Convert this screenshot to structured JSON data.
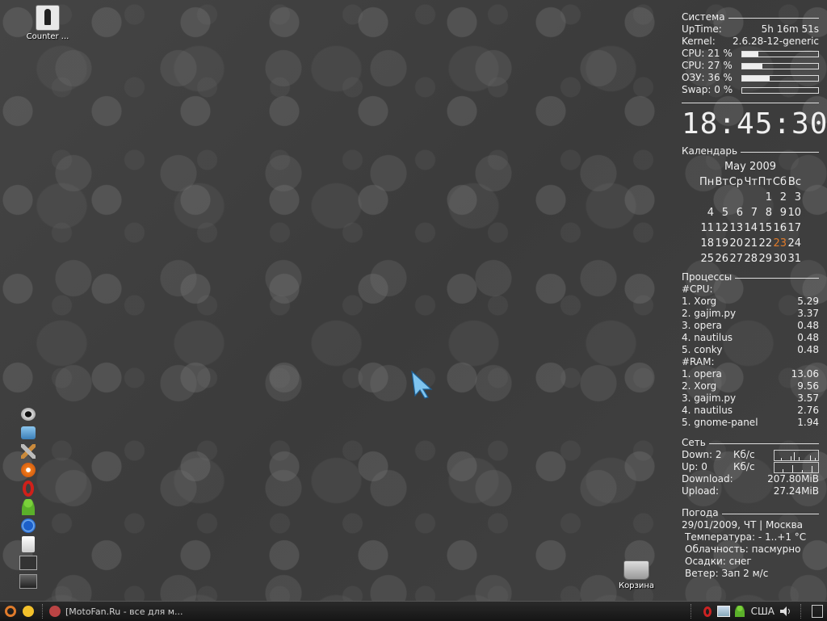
{
  "desktop": {
    "icons": [
      {
        "label": "Counter ...",
        "icon": "counter-strike-icon"
      },
      {
        "label": "Корзина",
        "icon": "trash-icon"
      }
    ]
  },
  "launcher": {
    "items": [
      {
        "icon": "webcam-icon"
      },
      {
        "icon": "telephone-icon"
      },
      {
        "icon": "tools-icon"
      },
      {
        "icon": "media-player-icon"
      },
      {
        "icon": "opera-icon"
      },
      {
        "icon": "messenger-icon"
      },
      {
        "icon": "power-icon"
      },
      {
        "icon": "text-editor-icon"
      },
      {
        "icon": "system-monitor-icon"
      },
      {
        "icon": "terminal-icon"
      }
    ]
  },
  "conky": {
    "system": {
      "title": "Система",
      "uptime_label": "UpTime:",
      "uptime_value": "5h 16m 51s",
      "kernel_label": "Kernel:",
      "kernel_value": "2.6.28-12-generic",
      "bars": [
        {
          "label": "CPU: 21 %",
          "value": 21
        },
        {
          "label": "CPU: 27 %",
          "value": 27
        },
        {
          "label": "ОЗУ: 36 %",
          "value": 36
        },
        {
          "label": "Swap: 0  %",
          "value": 0
        }
      ]
    },
    "clock": "18:45:30",
    "calendar": {
      "title": "Календарь",
      "month": "May  2009",
      "weekdays": [
        "Пн",
        "Вт",
        "Ср",
        "Чт",
        "Пт",
        "Сб",
        "Вс"
      ],
      "weeks": [
        [
          "",
          "",
          "",
          "",
          "1",
          "2",
          "3"
        ],
        [
          "4",
          "5",
          "6",
          "7",
          "8",
          "9",
          "10"
        ],
        [
          "11",
          "12",
          "13",
          "14",
          "15",
          "16",
          "17"
        ],
        [
          "18",
          "19",
          "20",
          "21",
          "22",
          "23",
          "24"
        ],
        [
          "25",
          "26",
          "27",
          "28",
          "29",
          "30",
          "31"
        ]
      ],
      "today": "23"
    },
    "processes": {
      "title": "Процессы",
      "cpu_header": "#CPU:",
      "cpu": [
        {
          "name": "1. Xorg",
          "value": "5.29"
        },
        {
          "name": "2. gajim.py",
          "value": "3.37"
        },
        {
          "name": "3. opera",
          "value": "0.48"
        },
        {
          "name": "4. nautilus",
          "value": "0.48"
        },
        {
          "name": "5. conky",
          "value": "0.48"
        }
      ],
      "ram_header": "#RAM:",
      "ram": [
        {
          "name": "1. opera",
          "value": "13.06"
        },
        {
          "name": "2. Xorg",
          "value": "9.56"
        },
        {
          "name": "3. gajim.py",
          "value": "3.57"
        },
        {
          "name": "4. nautilus",
          "value": "2.76"
        },
        {
          "name": "5. gnome-panel",
          "value": "1.94"
        }
      ]
    },
    "network": {
      "title": "Сеть",
      "down_label": "Down: 2",
      "down_unit": "Кб/с",
      "up_label": "Up: 0",
      "up_unit": "Кб/с",
      "download_label": "Download:",
      "download_value": "207.80MiB",
      "upload_label": "Upload:",
      "upload_value": "27.24MiB"
    },
    "weather": {
      "title": "Погода",
      "date_line": "29/01/2009, ЧТ | Москва",
      "temperature": "Температура: - 1..+1 °C",
      "clouds": "Облачность: пасмурно",
      "precip": "Осадки: снег",
      "wind": "Ветер: Зап 2 м/с"
    }
  },
  "taskbar": {
    "window_title": "[MotoFan.Ru - все для м...",
    "keyboard_layout": "США",
    "tray_icons": [
      "opera-tray-icon",
      "network-icon",
      "messenger-tray-icon",
      "volume-icon"
    ]
  },
  "colors": {
    "accent_today": "#e07b2b",
    "text": "#f0f0f0"
  }
}
